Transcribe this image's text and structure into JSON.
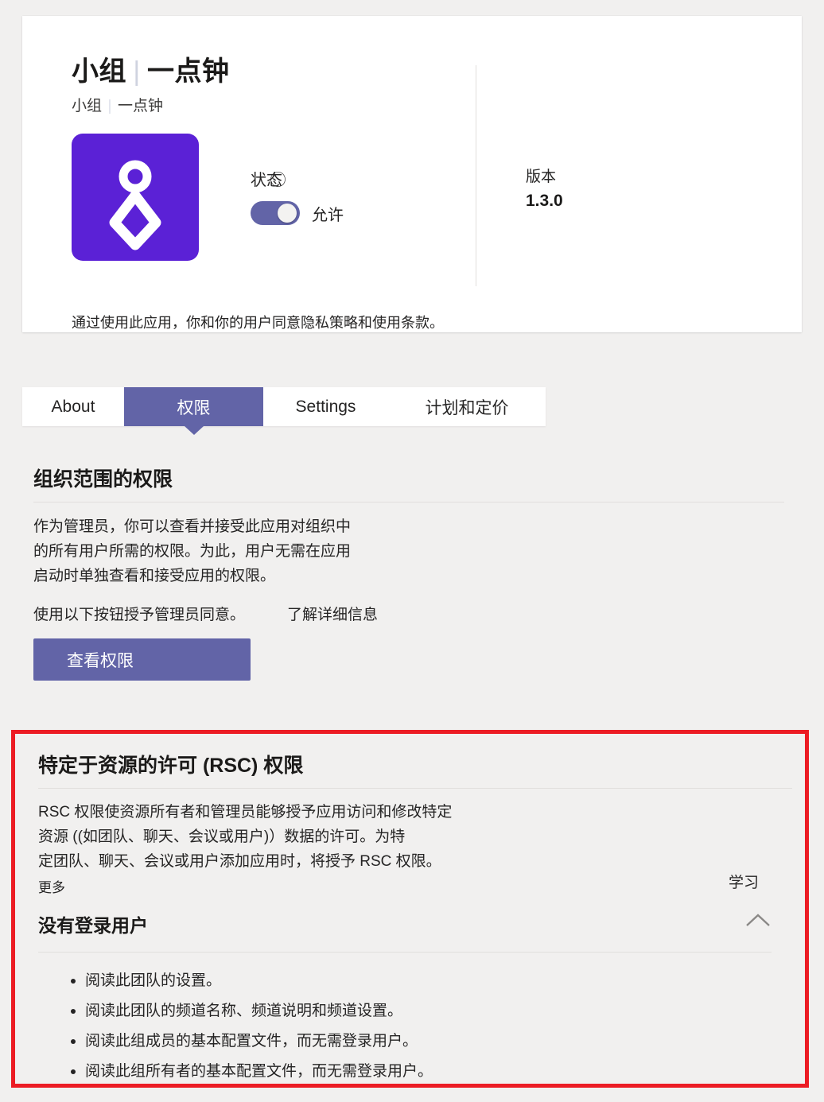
{
  "app": {
    "title_left": "小组",
    "title_sep": "|",
    "title_right": "一点钟",
    "subtitle_left": "小组",
    "subtitle_sep": "|",
    "subtitle_right": "一点钟",
    "icon_name": "app-logo-icon",
    "icon_bg": "#5b21d6",
    "status_label": "状态 ⃝",
    "toggle_state": "on",
    "toggle_color": "#6264a7",
    "toggle_text": "允许",
    "version_label": "版本",
    "version_value": "1.3.0",
    "privacy_note": "通过使用此应用，你和你的用户同意隐私策略和使用条款。"
  },
  "tabs": [
    {
      "label": "About",
      "active": false
    },
    {
      "label": "权限",
      "active": true
    },
    {
      "label": "Settings",
      "active": false
    },
    {
      "label": "计划和定价",
      "active": false
    }
  ],
  "org_permissions": {
    "heading": "组织范围的权限",
    "body_line1": "作为管理员，你可以查看并接受此应用对组织中",
    "body_line2": "的所有用户所需的权限。为此，用户无需在应用",
    "body_line3": "启动时单独查看和接受应用的权限。",
    "consent_text": "使用以下按钮授予管理员同意。",
    "learn_more_link": "了解详细信息",
    "button_label": "查看权限",
    "button_color": "#6264a7"
  },
  "rsc": {
    "highlight_color": "#ec1c24",
    "heading": "特定于资源的许可 (RSC) 权限",
    "body_line1": "RSC 权限使资源所有者和管理员能够授予应用访问和修改特定",
    "body_line2": "资源 ((如团队、聊天、会议或用户)）数据的许可。为特",
    "body_line3": "定团队、聊天、会议或用户添加应用时，将授予 RSC 权限。",
    "body_more": "更多",
    "learn_link": "学习",
    "collapse_title": "没有登录用户",
    "chevron_icon": "chevron-up-icon",
    "permissions": [
      "阅读此团队的设置。",
      "阅读此团队的频道名称、频道说明和频道设置。",
      "阅读此组成员的基本配置文件，而无需登录用户。",
      "阅读此组所有者的基本配置文件，而无需登录用户。"
    ]
  }
}
